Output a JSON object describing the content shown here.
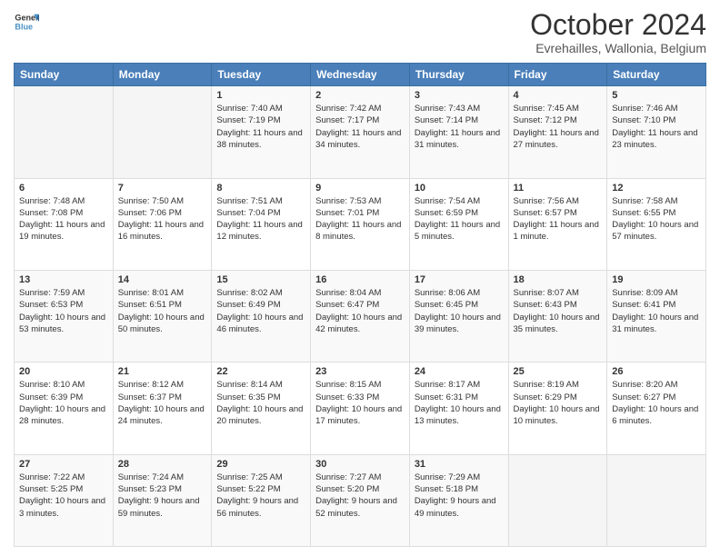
{
  "header": {
    "logo_line1": "General",
    "logo_line2": "Blue",
    "title": "October 2024",
    "subtitle": "Evrehailles, Wallonia, Belgium"
  },
  "days_of_week": [
    "Sunday",
    "Monday",
    "Tuesday",
    "Wednesday",
    "Thursday",
    "Friday",
    "Saturday"
  ],
  "weeks": [
    [
      {
        "num": "",
        "info": ""
      },
      {
        "num": "",
        "info": ""
      },
      {
        "num": "1",
        "info": "Sunrise: 7:40 AM\nSunset: 7:19 PM\nDaylight: 11 hours and 38 minutes."
      },
      {
        "num": "2",
        "info": "Sunrise: 7:42 AM\nSunset: 7:17 PM\nDaylight: 11 hours and 34 minutes."
      },
      {
        "num": "3",
        "info": "Sunrise: 7:43 AM\nSunset: 7:14 PM\nDaylight: 11 hours and 31 minutes."
      },
      {
        "num": "4",
        "info": "Sunrise: 7:45 AM\nSunset: 7:12 PM\nDaylight: 11 hours and 27 minutes."
      },
      {
        "num": "5",
        "info": "Sunrise: 7:46 AM\nSunset: 7:10 PM\nDaylight: 11 hours and 23 minutes."
      }
    ],
    [
      {
        "num": "6",
        "info": "Sunrise: 7:48 AM\nSunset: 7:08 PM\nDaylight: 11 hours and 19 minutes."
      },
      {
        "num": "7",
        "info": "Sunrise: 7:50 AM\nSunset: 7:06 PM\nDaylight: 11 hours and 16 minutes."
      },
      {
        "num": "8",
        "info": "Sunrise: 7:51 AM\nSunset: 7:04 PM\nDaylight: 11 hours and 12 minutes."
      },
      {
        "num": "9",
        "info": "Sunrise: 7:53 AM\nSunset: 7:01 PM\nDaylight: 11 hours and 8 minutes."
      },
      {
        "num": "10",
        "info": "Sunrise: 7:54 AM\nSunset: 6:59 PM\nDaylight: 11 hours and 5 minutes."
      },
      {
        "num": "11",
        "info": "Sunrise: 7:56 AM\nSunset: 6:57 PM\nDaylight: 11 hours and 1 minute."
      },
      {
        "num": "12",
        "info": "Sunrise: 7:58 AM\nSunset: 6:55 PM\nDaylight: 10 hours and 57 minutes."
      }
    ],
    [
      {
        "num": "13",
        "info": "Sunrise: 7:59 AM\nSunset: 6:53 PM\nDaylight: 10 hours and 53 minutes."
      },
      {
        "num": "14",
        "info": "Sunrise: 8:01 AM\nSunset: 6:51 PM\nDaylight: 10 hours and 50 minutes."
      },
      {
        "num": "15",
        "info": "Sunrise: 8:02 AM\nSunset: 6:49 PM\nDaylight: 10 hours and 46 minutes."
      },
      {
        "num": "16",
        "info": "Sunrise: 8:04 AM\nSunset: 6:47 PM\nDaylight: 10 hours and 42 minutes."
      },
      {
        "num": "17",
        "info": "Sunrise: 8:06 AM\nSunset: 6:45 PM\nDaylight: 10 hours and 39 minutes."
      },
      {
        "num": "18",
        "info": "Sunrise: 8:07 AM\nSunset: 6:43 PM\nDaylight: 10 hours and 35 minutes."
      },
      {
        "num": "19",
        "info": "Sunrise: 8:09 AM\nSunset: 6:41 PM\nDaylight: 10 hours and 31 minutes."
      }
    ],
    [
      {
        "num": "20",
        "info": "Sunrise: 8:10 AM\nSunset: 6:39 PM\nDaylight: 10 hours and 28 minutes."
      },
      {
        "num": "21",
        "info": "Sunrise: 8:12 AM\nSunset: 6:37 PM\nDaylight: 10 hours and 24 minutes."
      },
      {
        "num": "22",
        "info": "Sunrise: 8:14 AM\nSunset: 6:35 PM\nDaylight: 10 hours and 20 minutes."
      },
      {
        "num": "23",
        "info": "Sunrise: 8:15 AM\nSunset: 6:33 PM\nDaylight: 10 hours and 17 minutes."
      },
      {
        "num": "24",
        "info": "Sunrise: 8:17 AM\nSunset: 6:31 PM\nDaylight: 10 hours and 13 minutes."
      },
      {
        "num": "25",
        "info": "Sunrise: 8:19 AM\nSunset: 6:29 PM\nDaylight: 10 hours and 10 minutes."
      },
      {
        "num": "26",
        "info": "Sunrise: 8:20 AM\nSunset: 6:27 PM\nDaylight: 10 hours and 6 minutes."
      }
    ],
    [
      {
        "num": "27",
        "info": "Sunrise: 7:22 AM\nSunset: 5:25 PM\nDaylight: 10 hours and 3 minutes."
      },
      {
        "num": "28",
        "info": "Sunrise: 7:24 AM\nSunset: 5:23 PM\nDaylight: 9 hours and 59 minutes."
      },
      {
        "num": "29",
        "info": "Sunrise: 7:25 AM\nSunset: 5:22 PM\nDaylight: 9 hours and 56 minutes."
      },
      {
        "num": "30",
        "info": "Sunrise: 7:27 AM\nSunset: 5:20 PM\nDaylight: 9 hours and 52 minutes."
      },
      {
        "num": "31",
        "info": "Sunrise: 7:29 AM\nSunset: 5:18 PM\nDaylight: 9 hours and 49 minutes."
      },
      {
        "num": "",
        "info": ""
      },
      {
        "num": "",
        "info": ""
      }
    ]
  ]
}
